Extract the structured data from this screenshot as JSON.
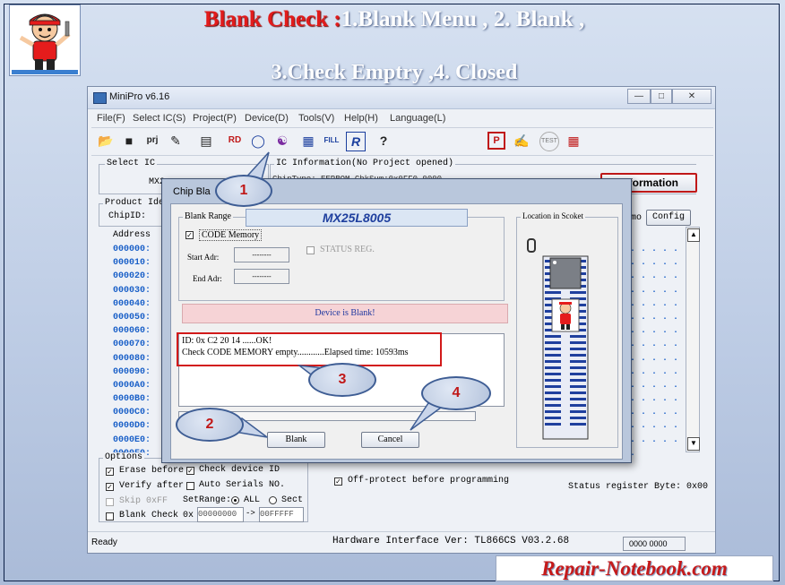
{
  "slide": {
    "title_red": "Blank Check :",
    "title_rest_line1": "1.Blank Menu , 2. Blank ,",
    "title_line2": "3.Check  Emptry ,4. Closed",
    "footer_brand": "Repair-Notebook.com"
  },
  "window": {
    "title": "MiniPro v6.16",
    "menus": [
      "File(F)",
      "Select IC(S)",
      "Project(P)",
      "Device(D)",
      "Tools(V)",
      "Help(H)",
      "Language(L)"
    ],
    "toolbar_icons": [
      "open-icon",
      "save-icon",
      "project-icon",
      "edit-icon",
      "hex-icon",
      "read-icon",
      "blank-check-icon",
      "verify-icon",
      "program-icon",
      "fill-icon",
      "r-icon",
      "help-icon",
      "p-icon",
      "notepad-icon",
      "test-icon",
      "chip-icon"
    ],
    "select_ic_label": "Select IC",
    "select_ic_value": "MX2",
    "ic_info_label": "IC Information(No Project opened)",
    "chip_type": "ChipType:  EEPROM     ChkSum:0x0FF0 0000",
    "information_button": "Information",
    "product_ident_label": "Product Iden",
    "chip_id_label": "ChipID:",
    "demo_label": "mo",
    "config_button": "Config",
    "address_header": "Address",
    "addresses": [
      "000000:",
      "000010:",
      "000020:",
      "000030:",
      "000040:",
      "000050:",
      "000060:",
      "000070:",
      "000080:",
      "000090:",
      "0000A0:",
      "0000B0:",
      "0000C0:",
      "0000D0:",
      "0000E0:",
      "0000F0:"
    ],
    "data_dots": ". . . . . .",
    "options": {
      "label": "Options",
      "erase_before": "Erase before",
      "check_device_id": "Check device ID",
      "verify_after": "Verify after",
      "auto_serials": "Auto Serials NO.",
      "skip_ff": "Skip 0xFF",
      "set_range": "SetRange:",
      "all": "ALL",
      "sect": "Sect",
      "blank_check": "Blank Check",
      "ox": "0x",
      "range_start": "00000000",
      "arrow": "->",
      "range_end": "00FFFFF"
    },
    "off_protect": "Off-protect before programming",
    "status_register": "Status register Byte: 0x00",
    "status_ready": "Ready",
    "hardware_interface": "Hardware Interface Ver: TL866CS V03.2.68",
    "status_code": "0000 0000"
  },
  "dialog": {
    "title": "Chip Bla",
    "blank_range_label": "Blank Range",
    "chip_name": "MX25L8005",
    "code_memory": "CODE Memory",
    "status_reg": "STATUS REG.",
    "start_adr_label": "Start Adr:",
    "end_adr_label": "End Adr:",
    "start_adr_value": "--------",
    "end_adr_value": "--------",
    "message": "Device is Blank!",
    "log_line1": "ID: 0x C2 20 14 ......OK!",
    "log_line2": "Check CODE MEMORY empty............Elapsed time: 10593ms",
    "blank_button": "Blank",
    "cancel_button": "Cancel",
    "location_label": "Location in Scoket"
  },
  "callouts": [
    "1",
    "2",
    "3",
    "4"
  ],
  "colors": {
    "accent_red": "#e21b1b",
    "address_blue": "#1a60c8",
    "message_bg": "#f6d3d6",
    "chip_blue": "#1f3f9e"
  }
}
